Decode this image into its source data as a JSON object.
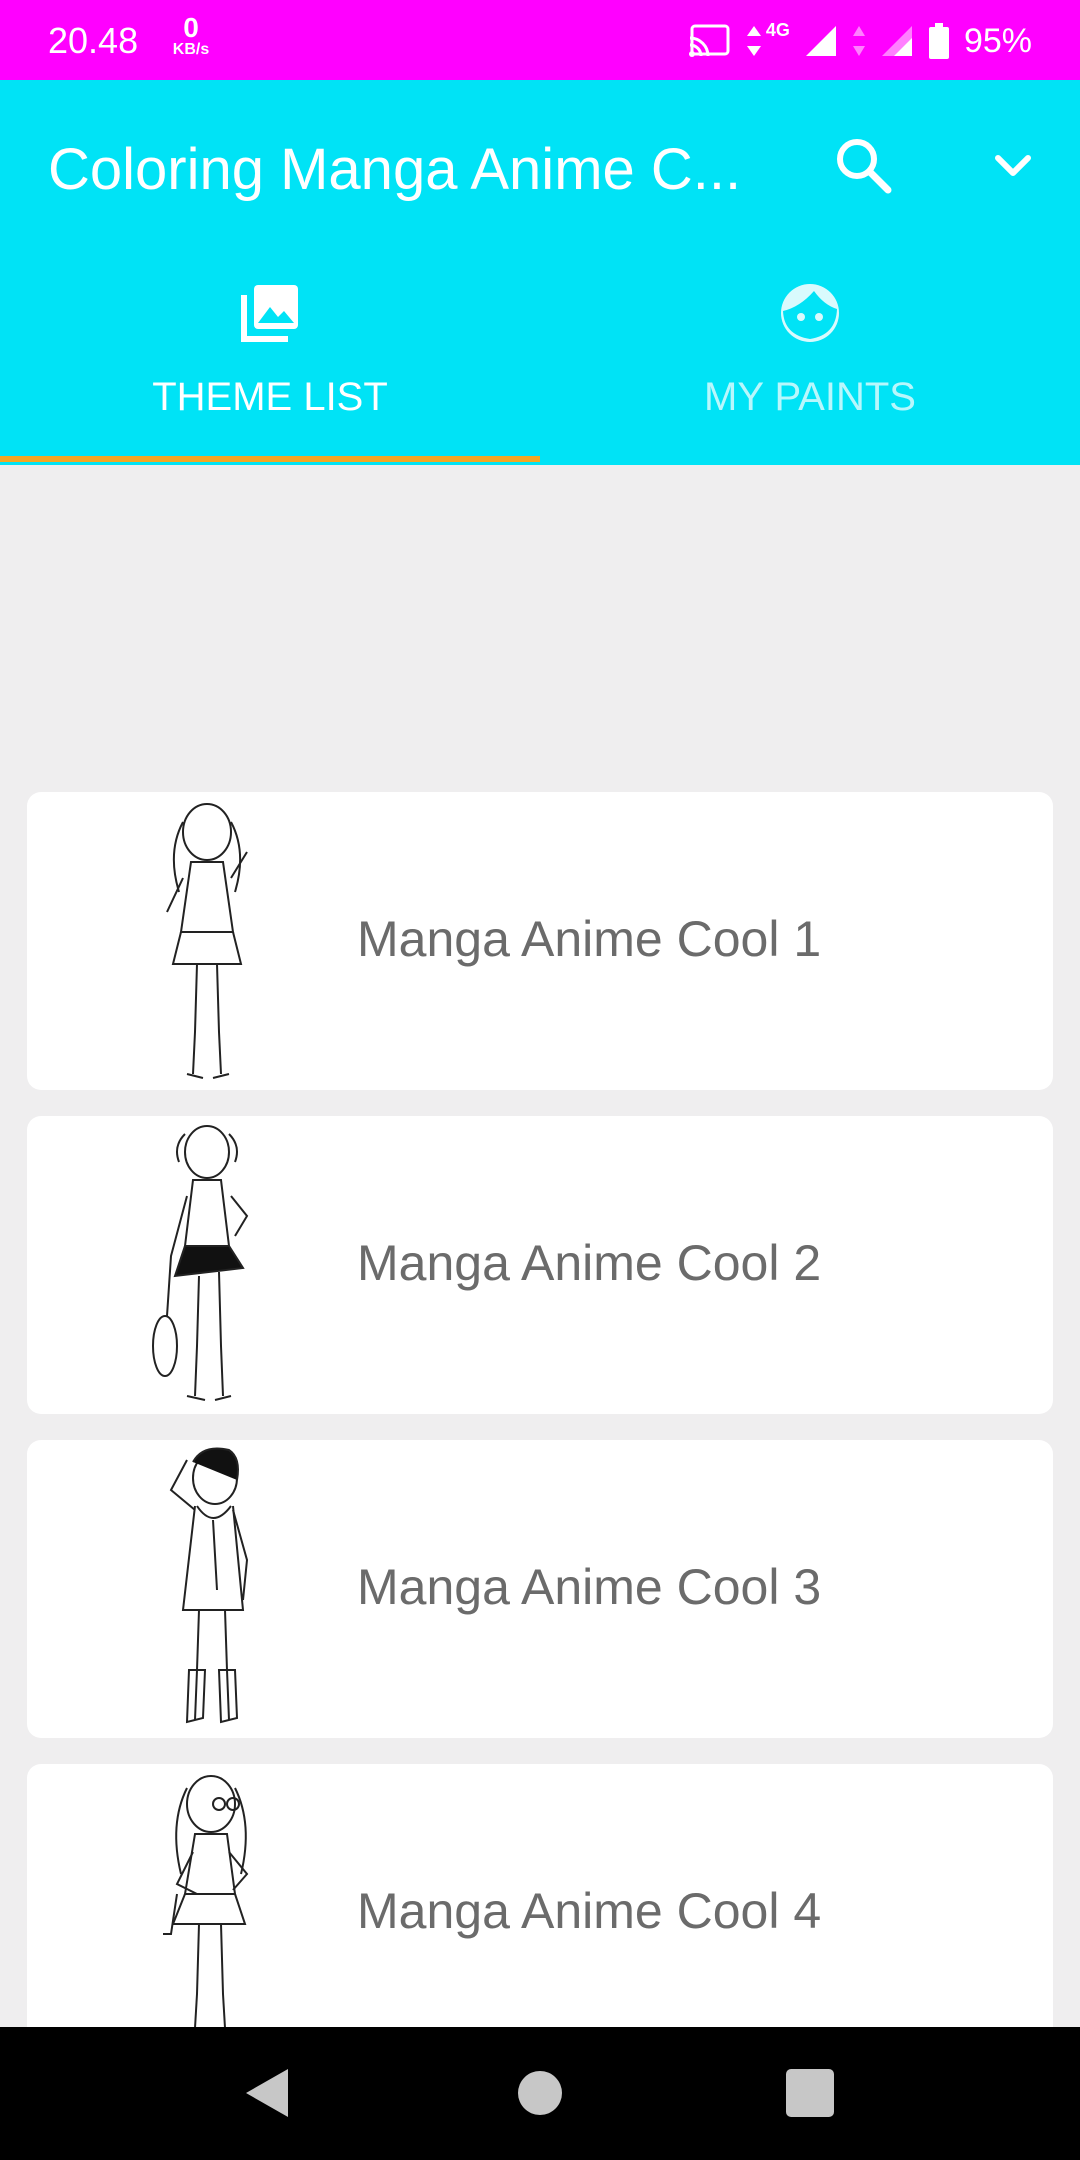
{
  "status_bar": {
    "time": "20.48",
    "net_speed_value": "0",
    "net_speed_unit": "KB/s",
    "network_type": "4G",
    "battery_percent": "95%",
    "icons": [
      "cast-icon",
      "data-arrows-icon",
      "signal-icon",
      "signal-icon",
      "battery-icon"
    ]
  },
  "app_bar": {
    "title": "Coloring Manga Anime C...",
    "search_icon": "search-icon",
    "dropdown_icon": "chevron-down-icon"
  },
  "tabs": [
    {
      "label": "THEME LIST",
      "icon": "photo-library-icon",
      "selected": true
    },
    {
      "label": "MY PAINTS",
      "icon": "face-icon",
      "selected": false
    }
  ],
  "theme_list": [
    {
      "title": "Manga Anime Cool 1",
      "thumbnail": "anime-girl-uniform-sketch"
    },
    {
      "title": "Manga Anime Cool 2",
      "thumbnail": "anime-girl-tennis-sketch"
    },
    {
      "title": "Manga Anime Cool 3",
      "thumbnail": "anime-girl-scarf-sketch"
    },
    {
      "title": "Manga Anime Cool 4",
      "thumbnail": "anime-girl-glasses-sketch"
    }
  ],
  "nav_bar": {
    "icons": [
      "back-icon",
      "home-icon",
      "recents-icon"
    ]
  },
  "colors": {
    "status_bar": "#ff00ff",
    "app_bar": "#00e3f6",
    "tab_indicator": "#f5a623",
    "background": "#efeeef",
    "card_text": "#6b6b6b"
  }
}
